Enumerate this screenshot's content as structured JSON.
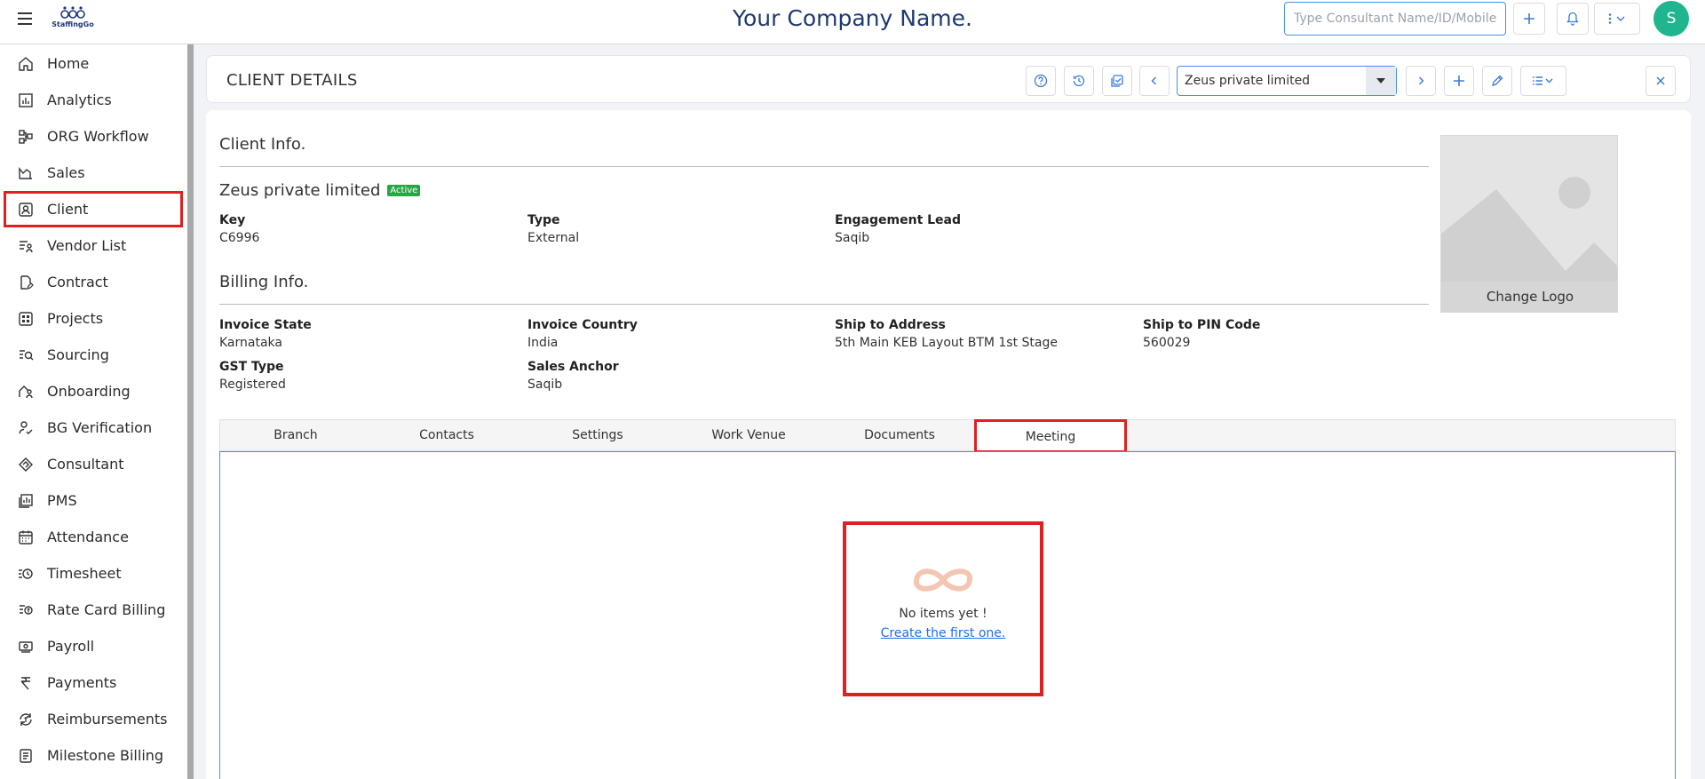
{
  "app": {
    "logo_text": "StaffingGo",
    "company_name": "Your Company Name.",
    "search_placeholder": "Type Consultant Name/ID/Mobile/...",
    "avatar_initial": "S"
  },
  "sidebar": {
    "items": [
      {
        "label": "Home",
        "icon": "home-icon"
      },
      {
        "label": "Analytics",
        "icon": "analytics-icon"
      },
      {
        "label": "ORG Workflow",
        "icon": "workflow-icon"
      },
      {
        "label": "Sales",
        "icon": "sales-icon"
      },
      {
        "label": "Client",
        "icon": "client-icon"
      },
      {
        "label": "Vendor List",
        "icon": "vendor-icon"
      },
      {
        "label": "Contract",
        "icon": "contract-icon"
      },
      {
        "label": "Projects",
        "icon": "projects-icon"
      },
      {
        "label": "Sourcing",
        "icon": "sourcing-icon"
      },
      {
        "label": "Onboarding",
        "icon": "onboarding-icon"
      },
      {
        "label": "BG Verification",
        "icon": "verification-icon"
      },
      {
        "label": "Consultant",
        "icon": "consultant-icon"
      },
      {
        "label": "PMS",
        "icon": "pms-icon"
      },
      {
        "label": "Attendance",
        "icon": "calendar-icon"
      },
      {
        "label": "Timesheet",
        "icon": "timesheet-icon"
      },
      {
        "label": "Rate Card Billing",
        "icon": "rate-card-icon"
      },
      {
        "label": "Payroll",
        "icon": "payroll-icon"
      },
      {
        "label": "Payments",
        "icon": "rupee-icon"
      },
      {
        "label": "Reimbursements",
        "icon": "reimbursement-icon"
      },
      {
        "label": "Milestone Billing",
        "icon": "milestone-icon"
      }
    ]
  },
  "header": {
    "title": "CLIENT DETAILS",
    "selected_client": "Zeus private limited"
  },
  "client_info": {
    "section_title": "Client Info.",
    "name": "Zeus private limited",
    "status": "Active",
    "key_label": "Key",
    "key_value": "C6996",
    "type_label": "Type",
    "type_value": "External",
    "lead_label": "Engagement Lead",
    "lead_value": "Saqib"
  },
  "billing_info": {
    "section_title": "Billing Info.",
    "invoice_state_label": "Invoice State",
    "invoice_state_value": "Karnataka",
    "invoice_country_label": "Invoice Country",
    "invoice_country_value": "India",
    "ship_address_label": "Ship to Address",
    "ship_address_value": "5th Main KEB Layout BTM 1st Stage",
    "ship_pin_label": "Ship to PIN Code",
    "ship_pin_value": "560029",
    "gst_label": "GST Type",
    "gst_value": "Registered",
    "anchor_label": "Sales Anchor",
    "anchor_value": "Saqib"
  },
  "logo_box": {
    "change_label": "Change Logo"
  },
  "tabs": [
    "Branch",
    "Contacts",
    "Settings",
    "Work Venue",
    "Documents",
    "Meeting"
  ],
  "empty_state": {
    "message": "No items yet !",
    "link": "Create the first one."
  },
  "colors": {
    "accent": "#3a7bd5",
    "highlight": "#e02020",
    "active_badge": "#28a745",
    "avatar": "#1fb58f"
  }
}
